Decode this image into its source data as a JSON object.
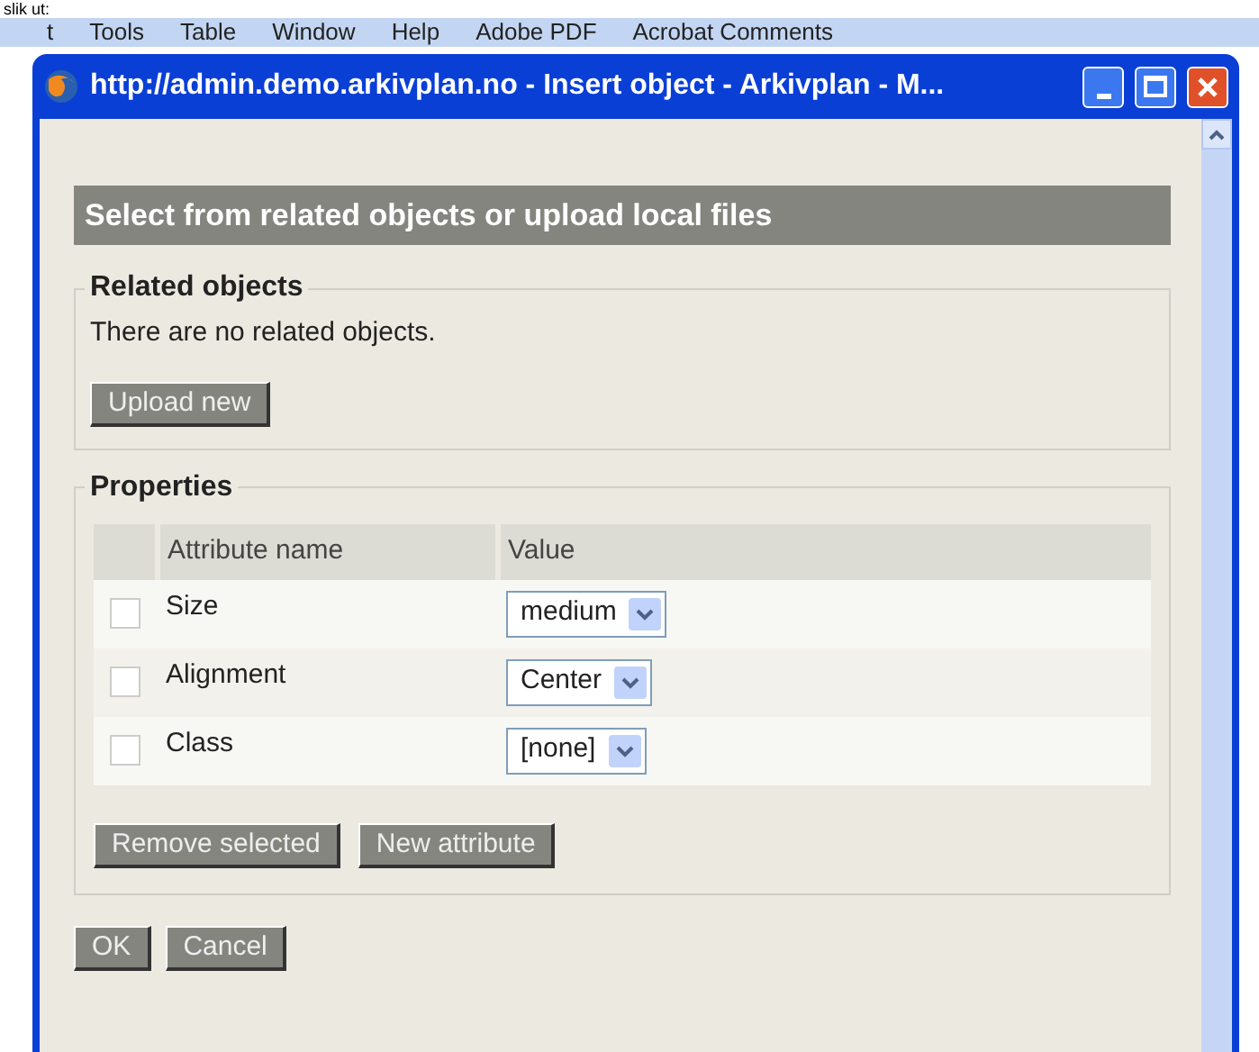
{
  "document_text": "slik ut:",
  "menu_bar": [
    "t",
    "Tools",
    "Table",
    "Window",
    "Help",
    "Adobe PDF",
    "Acrobat Comments"
  ],
  "window": {
    "title": "http://admin.demo.arkivplan.no - Insert object - Arkivplan - M..."
  },
  "heading": "Select from related objects or upload local files",
  "related_objects": {
    "legend": "Related objects",
    "message": "There are no related objects.",
    "button": "Upload new"
  },
  "properties": {
    "legend": "Properties",
    "columns": [
      "Attribute name",
      "Value"
    ],
    "rows": [
      {
        "name": "Size",
        "value": "medium",
        "checked": false
      },
      {
        "name": "Alignment",
        "value": "Center",
        "checked": false
      },
      {
        "name": "Class",
        "value": "[none]",
        "checked": false
      }
    ],
    "buttons": [
      "Remove selected",
      "New attribute"
    ]
  },
  "buttons": [
    "OK",
    "Cancel"
  ]
}
